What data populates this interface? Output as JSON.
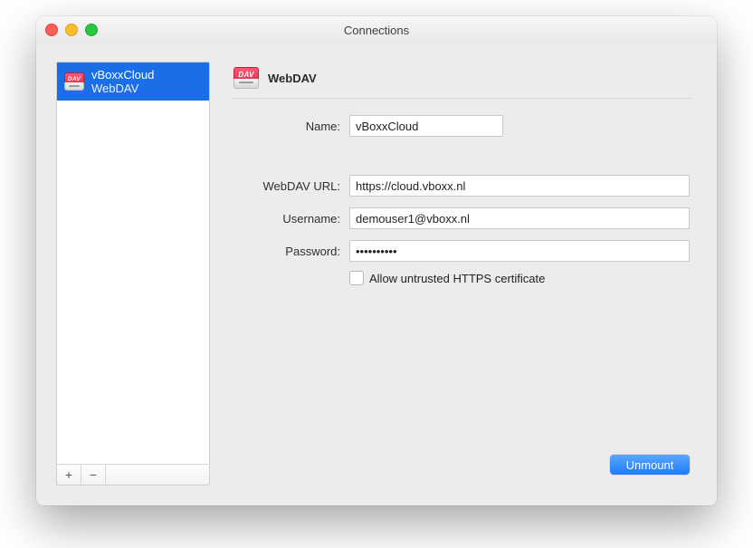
{
  "window": {
    "title": "Connections"
  },
  "sidebar": {
    "items": [
      {
        "title": "vBoxxCloud",
        "subtitle": "WebDAV"
      }
    ],
    "add_label": "+",
    "remove_label": "−"
  },
  "panel": {
    "title": "WebDAV",
    "icon_text": "DAV",
    "labels": {
      "name": "Name:",
      "url": "WebDAV URL:",
      "username": "Username:",
      "password": "Password:",
      "allow_untrusted": "Allow untrusted HTTPS certificate"
    },
    "values": {
      "name": "vBoxxCloud",
      "url": "https://cloud.vboxx.nl",
      "username": "demouser1@vboxx.nl",
      "password": "••••••••••",
      "allow_untrusted": false
    },
    "buttons": {
      "unmount": "Unmount"
    }
  }
}
